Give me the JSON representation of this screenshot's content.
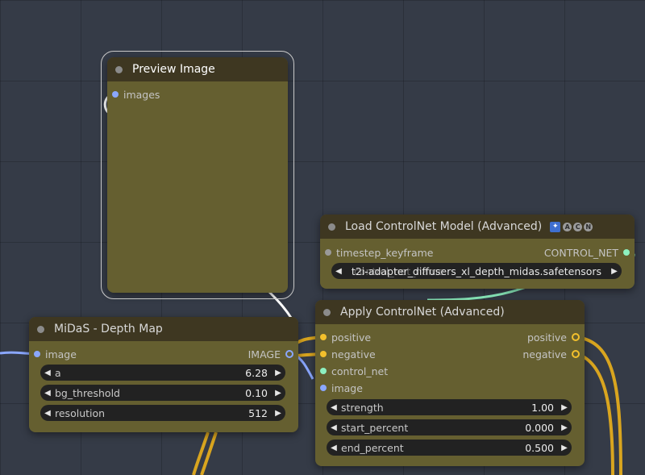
{
  "nodes": {
    "preview": {
      "title": "Preview Image",
      "inputs": [
        "images"
      ]
    },
    "load_controlnet": {
      "title": "Load ControlNet Model (Advanced)",
      "badge_letters": [
        "A",
        "C",
        "N"
      ],
      "inputs": [
        "timestep_keyframe"
      ],
      "outputs": [
        "CONTROL_NET"
      ],
      "model_widget": {
        "value": "t2i-adapter_diffusers_xl_depth_midas.safetensors",
        "ghost_text": "control_net_name"
      }
    },
    "midas": {
      "title": "MiDaS - Depth Map",
      "inputs": [
        "image"
      ],
      "outputs": [
        "IMAGE"
      ],
      "widgets": [
        {
          "label": "a",
          "value": "6.28"
        },
        {
          "label": "bg_threshold",
          "value": "0.10"
        },
        {
          "label": "resolution",
          "value": "512"
        }
      ]
    },
    "apply_controlnet": {
      "title": "Apply ControlNet (Advanced)",
      "inputs": [
        "positive",
        "negative",
        "control_net",
        "image"
      ],
      "outputs": [
        "positive",
        "negative"
      ],
      "widgets": [
        {
          "label": "strength",
          "value": "1.00"
        },
        {
          "label": "start_percent",
          "value": "0.000"
        },
        {
          "label": "end_percent",
          "value": "0.500"
        }
      ]
    }
  },
  "colors": {
    "canvas": "#353b47",
    "node_body": "#655f30",
    "node_header": "#3e3721",
    "widget_bg": "#222222",
    "image_link": "#8aa7ff",
    "conditioning_link": "#f3c02c",
    "controlnet_link": "#8df0c0",
    "selected_link": "#ffffff"
  },
  "icons": {
    "left_arrow": "◀",
    "right_arrow": "▶"
  }
}
